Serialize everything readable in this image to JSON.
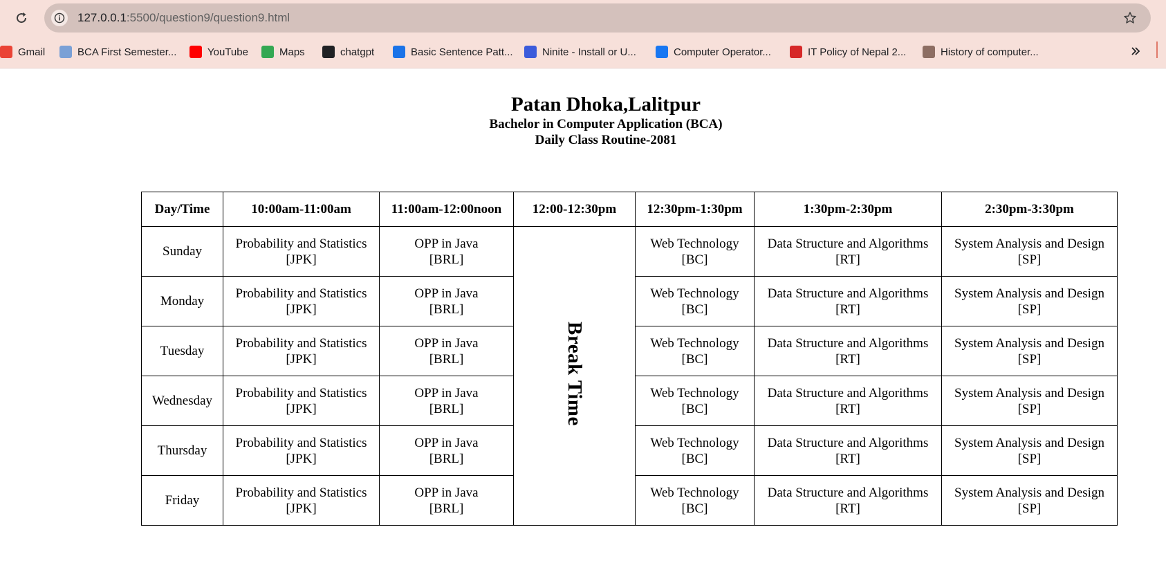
{
  "browser": {
    "url_host": "127.0.0.1",
    "url_path": ":5500/question9/question9.html",
    "bookmarks": [
      {
        "label": "Gmail",
        "icon": "gmail-icon",
        "color": "#ea4335"
      },
      {
        "label": "BCA First Semester...",
        "icon": "page-icon",
        "color": "#7aa0d6"
      },
      {
        "label": "YouTube",
        "icon": "youtube-icon",
        "color": "#ff0000"
      },
      {
        "label": "Maps",
        "icon": "maps-icon",
        "color": "#34a853"
      },
      {
        "label": "chatgpt",
        "icon": "chatgpt-icon",
        "color": "#202124"
      },
      {
        "label": "Basic Sentence Patt...",
        "icon": "infinity-icon",
        "color": "#1a73e8"
      },
      {
        "label": "Ninite - Install or U...",
        "icon": "ninite-icon",
        "color": "#3b5bdb"
      },
      {
        "label": "Computer Operator...",
        "icon": "facebook-icon",
        "color": "#1877f2"
      },
      {
        "label": "IT Policy of Nepal 2...",
        "icon": "news-icon",
        "color": "#d62828"
      },
      {
        "label": "History of computer...",
        "icon": "photo-icon",
        "color": "#8d6e63"
      }
    ]
  },
  "page": {
    "title": "Patan Dhoka,Lalitpur",
    "subtitle": "Bachelor in Computer Application (BCA)",
    "routine_title": "Daily Class Routine-2081"
  },
  "table": {
    "headers": [
      "Day/Time",
      "10:00am-11:00am",
      "11:00am-12:00noon",
      "12:00-12:30pm",
      "12:30pm-1:30pm",
      "1:30pm-2:30pm",
      "2:30pm-3:30pm"
    ],
    "break_label": "Break Time",
    "rows": [
      {
        "day": "Sunday",
        "c1": [
          "Probability and Statistics",
          "[JPK]"
        ],
        "c2": [
          "OPP in Java",
          "[BRL]"
        ],
        "c4": [
          "Web Technology",
          "[BC]"
        ],
        "c5": [
          "Data Structure and Algorithms",
          "[RT]"
        ],
        "c6": [
          "System Analysis and Design",
          "[SP]"
        ]
      },
      {
        "day": "Monday",
        "c1": [
          "Probability and Statistics",
          "[JPK]"
        ],
        "c2": [
          "OPP in Java",
          "[BRL]"
        ],
        "c4": [
          "Web Technology",
          "[BC]"
        ],
        "c5": [
          "Data Structure and Algorithms",
          "[RT]"
        ],
        "c6": [
          "System Analysis and Design",
          "[SP]"
        ]
      },
      {
        "day": "Tuesday",
        "c1": [
          "Probability and Statistics",
          "[JPK]"
        ],
        "c2": [
          "OPP in Java",
          "[BRL]"
        ],
        "c4": [
          "Web Technology",
          "[BC]"
        ],
        "c5": [
          "Data Structure and Algorithms",
          "[RT]"
        ],
        "c6": [
          "System Analysis and Design",
          "[SP]"
        ]
      },
      {
        "day": "Wednesday",
        "c1": [
          "Probability and Statistics",
          "[JPK]"
        ],
        "c2": [
          "OPP in Java",
          "[BRL]"
        ],
        "c4": [
          "Web Technology",
          "[BC]"
        ],
        "c5": [
          "Data Structure and Algorithms",
          "[RT]"
        ],
        "c6": [
          "System Analysis and Design",
          "[SP]"
        ]
      },
      {
        "day": "Thursday",
        "c1": [
          "Probability and Statistics",
          "[JPK]"
        ],
        "c2": [
          "OPP in Java",
          "[BRL]"
        ],
        "c4": [
          "Web Technology",
          "[BC]"
        ],
        "c5": [
          "Data Structure and Algorithms",
          "[RT]"
        ],
        "c6": [
          "System Analysis and Design",
          "[SP]"
        ]
      },
      {
        "day": "Friday",
        "c1": [
          "Probability and Statistics",
          "[JPK]"
        ],
        "c2": [
          "OPP in Java",
          "[BRL]"
        ],
        "c4": [
          "Web Technology",
          "[BC]"
        ],
        "c5": [
          "Data Structure and Algorithms",
          "[RT]"
        ],
        "c6": [
          "System Analysis and Design",
          "[SP]"
        ]
      }
    ]
  }
}
